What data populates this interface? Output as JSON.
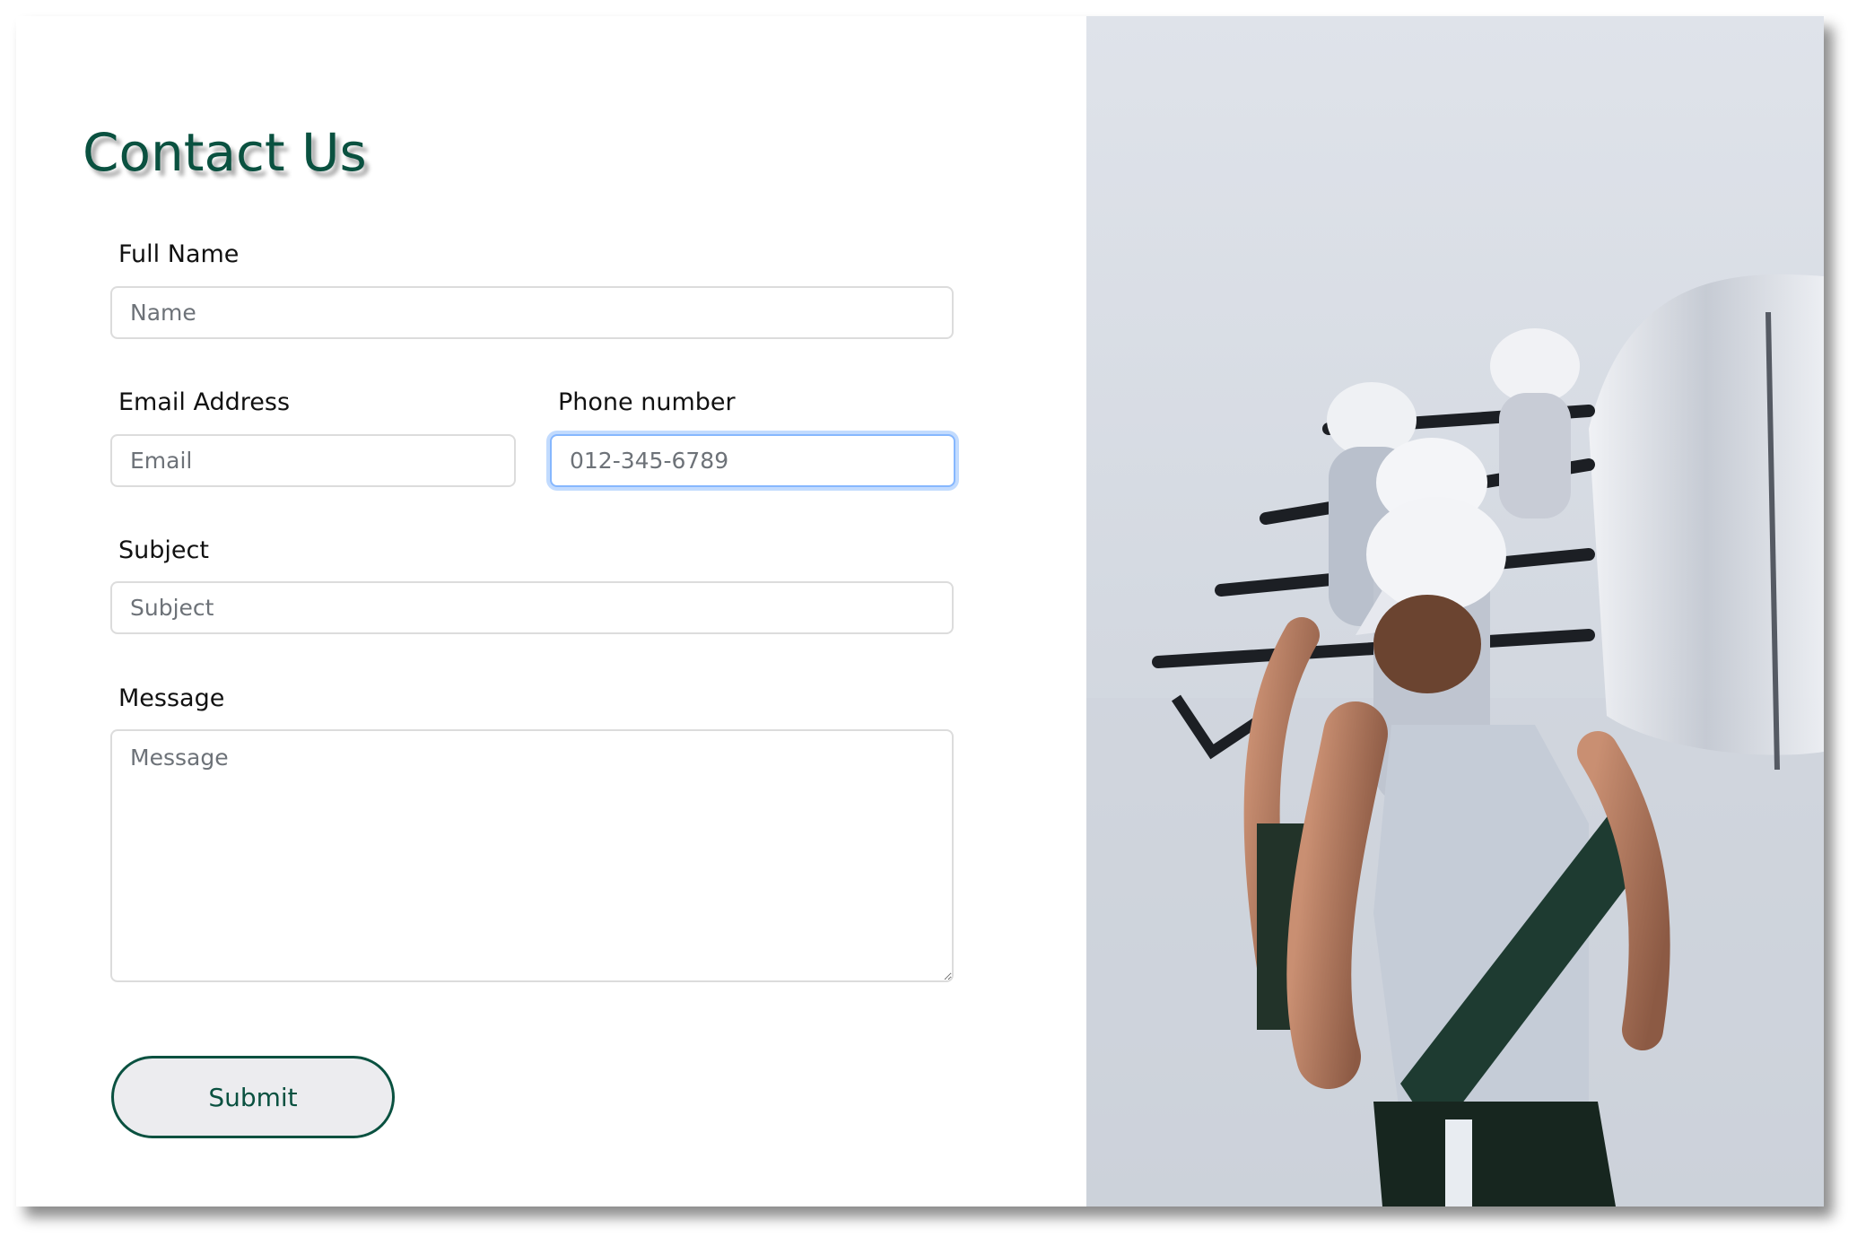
{
  "page": {
    "title": "Contact Us"
  },
  "form": {
    "full_name": {
      "label": "Full Name",
      "placeholder": "Name",
      "value": ""
    },
    "email": {
      "label": "Email Address",
      "placeholder": "Email",
      "value": ""
    },
    "phone": {
      "label": "Phone number",
      "placeholder": "012-345-6789",
      "value": "",
      "focused": true
    },
    "subject": {
      "label": "Subject",
      "placeholder": "Subject",
      "value": ""
    },
    "message": {
      "label": "Message",
      "placeholder": "Message",
      "value": ""
    },
    "submit_label": "Submit"
  },
  "colors": {
    "brand_green": "#0a5140",
    "focus_ring": "#86b7fe",
    "field_border": "#dcdcdc",
    "button_bg": "#ececef"
  },
  "hero_image": {
    "icon": "rowing-team-photo"
  }
}
